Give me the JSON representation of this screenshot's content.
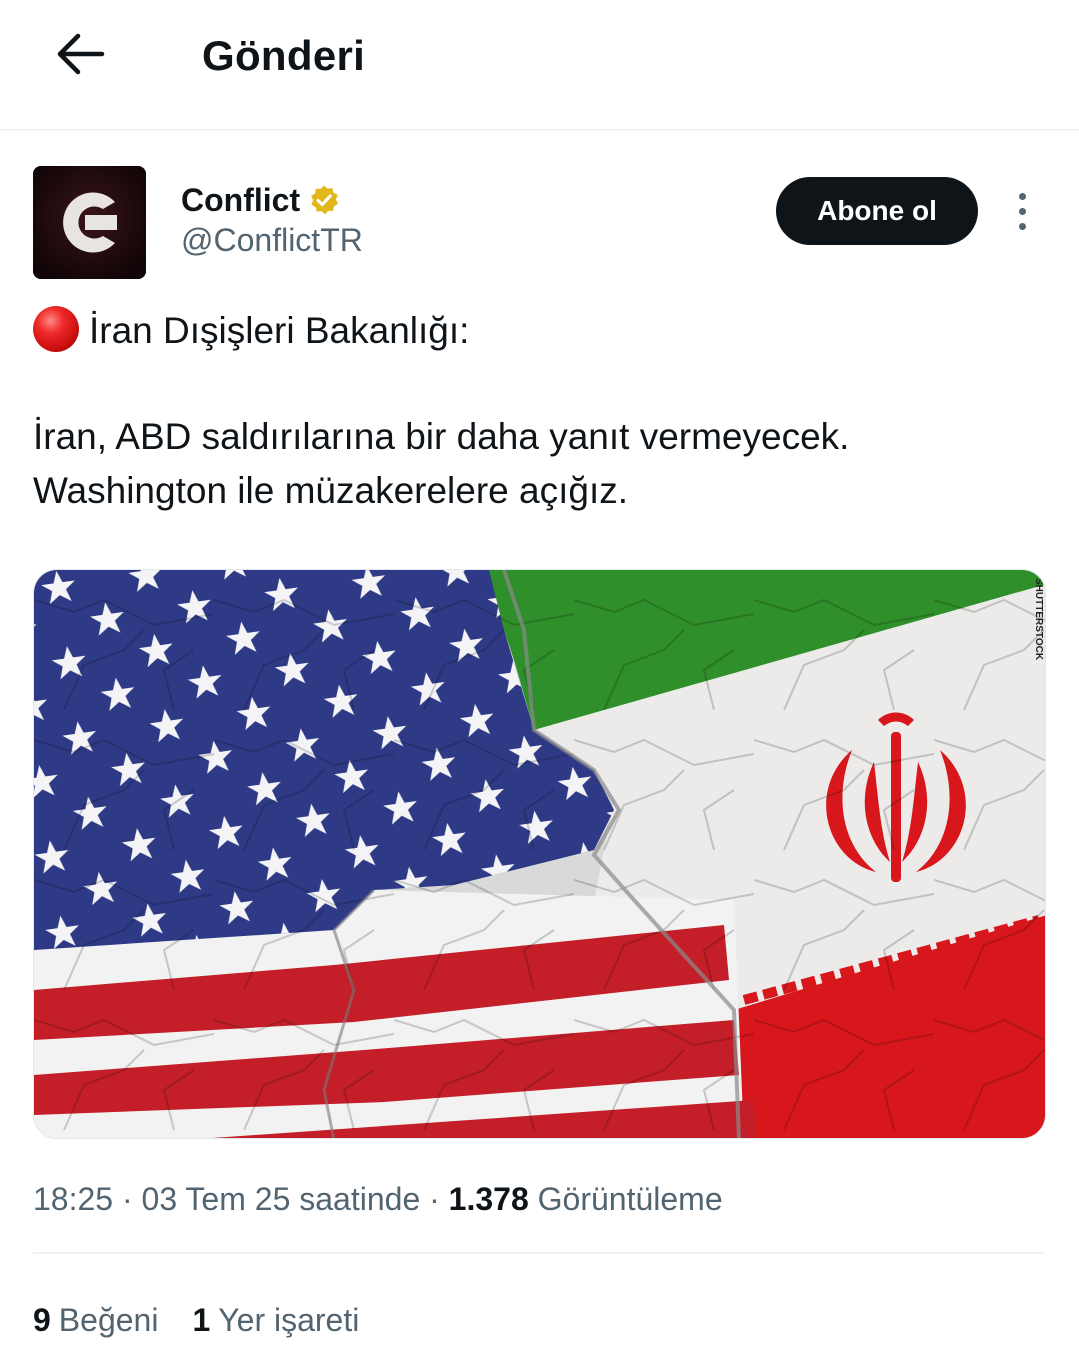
{
  "header": {
    "title": "Gönderi",
    "back_icon": "arrow-left-icon"
  },
  "author": {
    "name": "Conflict",
    "handle": "@ConflictTR",
    "verified_badge_color": "#e2b719",
    "avatar_letter": "C"
  },
  "follow_button": {
    "label": "Abone ol"
  },
  "tweet": {
    "emoji": "red-circle",
    "line1": "İran Dışişleri Bakanlığı:",
    "line2": "İran, ABD saldırılarına bir daha yanıt vermeyecek.",
    "line3": "Washington ile müzakerelere açığız."
  },
  "media": {
    "watermark": "SHUTTERSTOCK",
    "colors": {
      "us_blue": "#2e3a86",
      "us_red": "#c41f28",
      "iran_green": "#2f8f2a",
      "iran_red": "#d8171d"
    }
  },
  "meta": {
    "time": "18:25",
    "date": "03 Tem 25 saatinde",
    "views_count": "1.378",
    "views_label": "Görüntüleme"
  },
  "stats": {
    "likes_count": "9",
    "likes_label": "Beğeni",
    "bookmarks_count": "1",
    "bookmarks_label": "Yer işareti"
  }
}
